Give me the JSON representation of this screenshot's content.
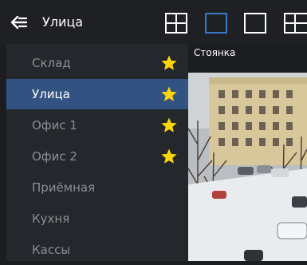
{
  "header": {
    "title": "Улица",
    "back_icon": "back-arrow-icon",
    "layouts": [
      {
        "name": "grid-2x2-icon",
        "selected": false
      },
      {
        "name": "single-view-icon",
        "selected": true
      },
      {
        "name": "single-view-alt-icon",
        "selected": false
      },
      {
        "name": "grid-2x2-alt-icon",
        "selected": false
      }
    ]
  },
  "sidebar": {
    "items": [
      {
        "label": "Склад",
        "favorite": true,
        "selected": false
      },
      {
        "label": "Улица",
        "favorite": true,
        "selected": true
      },
      {
        "label": "Офис 1",
        "favorite": true,
        "selected": false
      },
      {
        "label": "Офис 2",
        "favorite": true,
        "selected": false
      },
      {
        "label": "Приёмная",
        "favorite": false,
        "selected": false
      },
      {
        "label": "Кухня",
        "favorite": false,
        "selected": false
      },
      {
        "label": "Кассы",
        "favorite": false,
        "selected": false
      }
    ]
  },
  "camera": {
    "label": "Стоянка"
  },
  "colors": {
    "accent": "#3c78c8",
    "selected_bg": "#325381",
    "star": "#ffd600"
  }
}
